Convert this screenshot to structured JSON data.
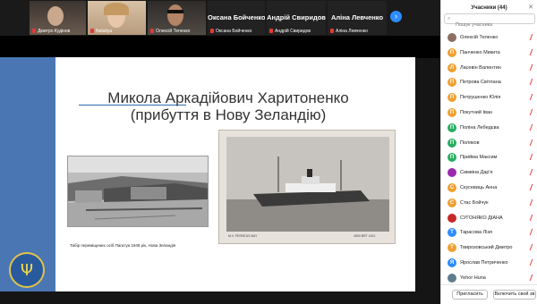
{
  "video_tiles": [
    {
      "name": "Дмитро Кудінов",
      "cam_color": "#6a5a4e"
    },
    {
      "name": "Nataliya",
      "cam_color": "#b89b7e"
    },
    {
      "name": "Олексій Тепенко",
      "cam_color": "#504a44"
    },
    {
      "name": "Оксана Бойченко",
      "big": "Оксана Бойченко"
    },
    {
      "name": "Андрій Свиридов",
      "big": "Андрій Свиридов"
    },
    {
      "name": "Аліна Левченко",
      "big": "Аліна Левченко"
    }
  ],
  "next_page_icon": "chevron-right-icon",
  "slide": {
    "title_line1": "Микола Аркадійович Харитоненко",
    "title_line2": "(прибуття в Нову Зеландію)",
    "caption": "Табір переміщених осіб Пагатуа 1949 рік, Нова Зеландія",
    "ship_caption_left": "M.V. PERSEUS BAY",
    "ship_caption_right": "4500 BRT 1921",
    "accent_color": "#4a77b4"
  },
  "participants": {
    "title": "Учасники (44)",
    "search_placeholder": "Пошук учасника",
    "list": [
      {
        "initial": "",
        "name": "Олексій Теленко",
        "color": "#8d6e63"
      },
      {
        "initial": "П",
        "name": "Панченко Микита",
        "color": "#f0a030"
      },
      {
        "initial": "Л",
        "name": "Ласевін Валентин",
        "color": "#f0a030"
      },
      {
        "initial": "П",
        "name": "Петрова Світлана",
        "color": "#f0a030"
      },
      {
        "initial": "П",
        "name": "Петрушенко Юлія",
        "color": "#f0a030"
      },
      {
        "initial": "П",
        "name": "Покутний Іван",
        "color": "#f0a030"
      },
      {
        "initial": "П",
        "name": "Поліна Лебедєва",
        "color": "#27ae60"
      },
      {
        "initial": "П",
        "name": "Поляков",
        "color": "#27ae60"
      },
      {
        "initial": "П",
        "name": "Прийма Максим",
        "color": "#27ae60"
      },
      {
        "initial": "",
        "name": "Симвіна Дар'я",
        "color": "#9c27b0"
      },
      {
        "initial": "С",
        "name": "Скусевиць Анна",
        "color": "#f0a030"
      },
      {
        "initial": "С",
        "name": "Стас Бойчук",
        "color": "#f0a030"
      },
      {
        "initial": "",
        "name": "СУГОНЯКО ДІАНА",
        "color": "#c62828"
      },
      {
        "initial": "Т",
        "name": "Тарасова Лізя",
        "color": "#2d8cff"
      },
      {
        "initial": "Т",
        "name": "Твирозовський Дмитро",
        "color": "#f0a030"
      },
      {
        "initial": "Я",
        "name": "Ярослав Петриченко",
        "color": "#2d8cff"
      },
      {
        "initial": "",
        "name": "Yehor Huna",
        "color": "#607d8b"
      }
    ],
    "invite_label": "Пригласить",
    "mute_all_label": "Включить свой зв"
  }
}
